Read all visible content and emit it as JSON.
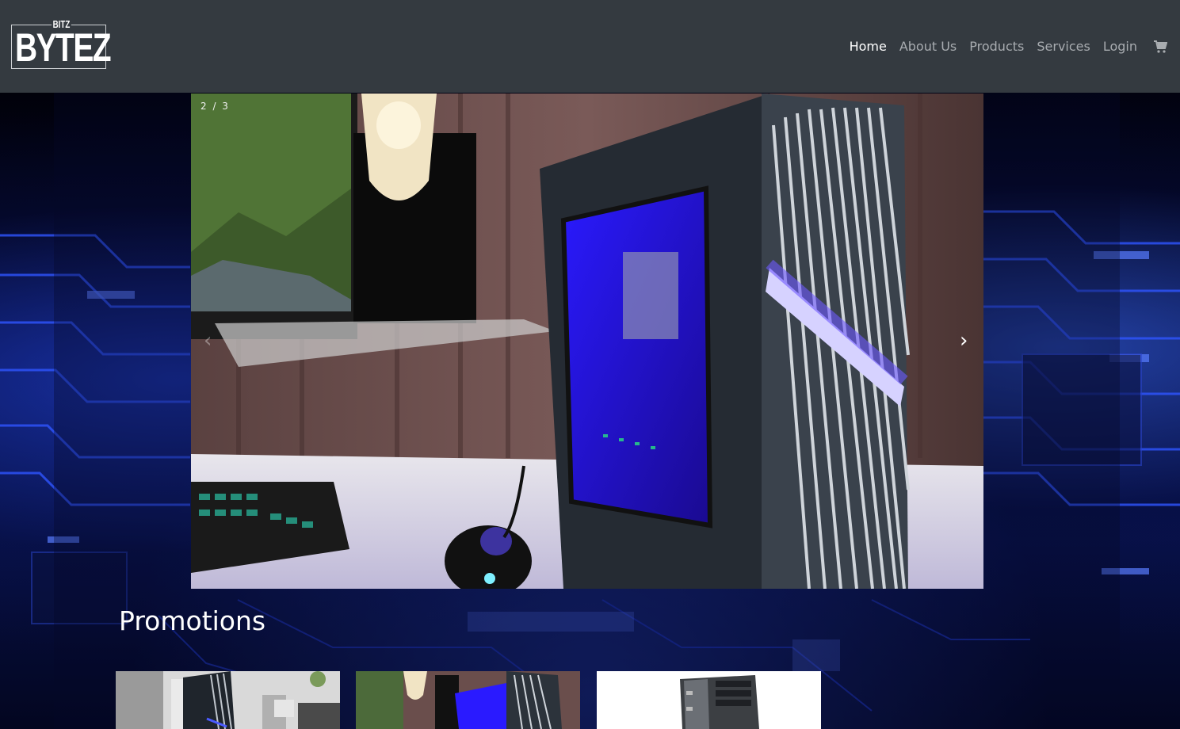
{
  "brand": {
    "small_text": "BITZ",
    "big_text": "BYTEZ"
  },
  "nav": {
    "items": [
      {
        "label": "Home",
        "active": true
      },
      {
        "label": "About Us",
        "active": false
      },
      {
        "label": "Products",
        "active": false
      },
      {
        "label": "Services",
        "active": false
      },
      {
        "label": "Login",
        "active": false
      }
    ],
    "cart_icon": "cart-icon"
  },
  "carousel": {
    "counter": "2 / 3",
    "prev_icon": "‹",
    "next_icon": "›"
  },
  "promotions": {
    "title": "Promotions"
  },
  "colors": {
    "navbar_bg": "#343a40",
    "nav_text": "#a8acb0",
    "nav_active": "#ffffff",
    "accent_blue": "#3b5bff"
  }
}
